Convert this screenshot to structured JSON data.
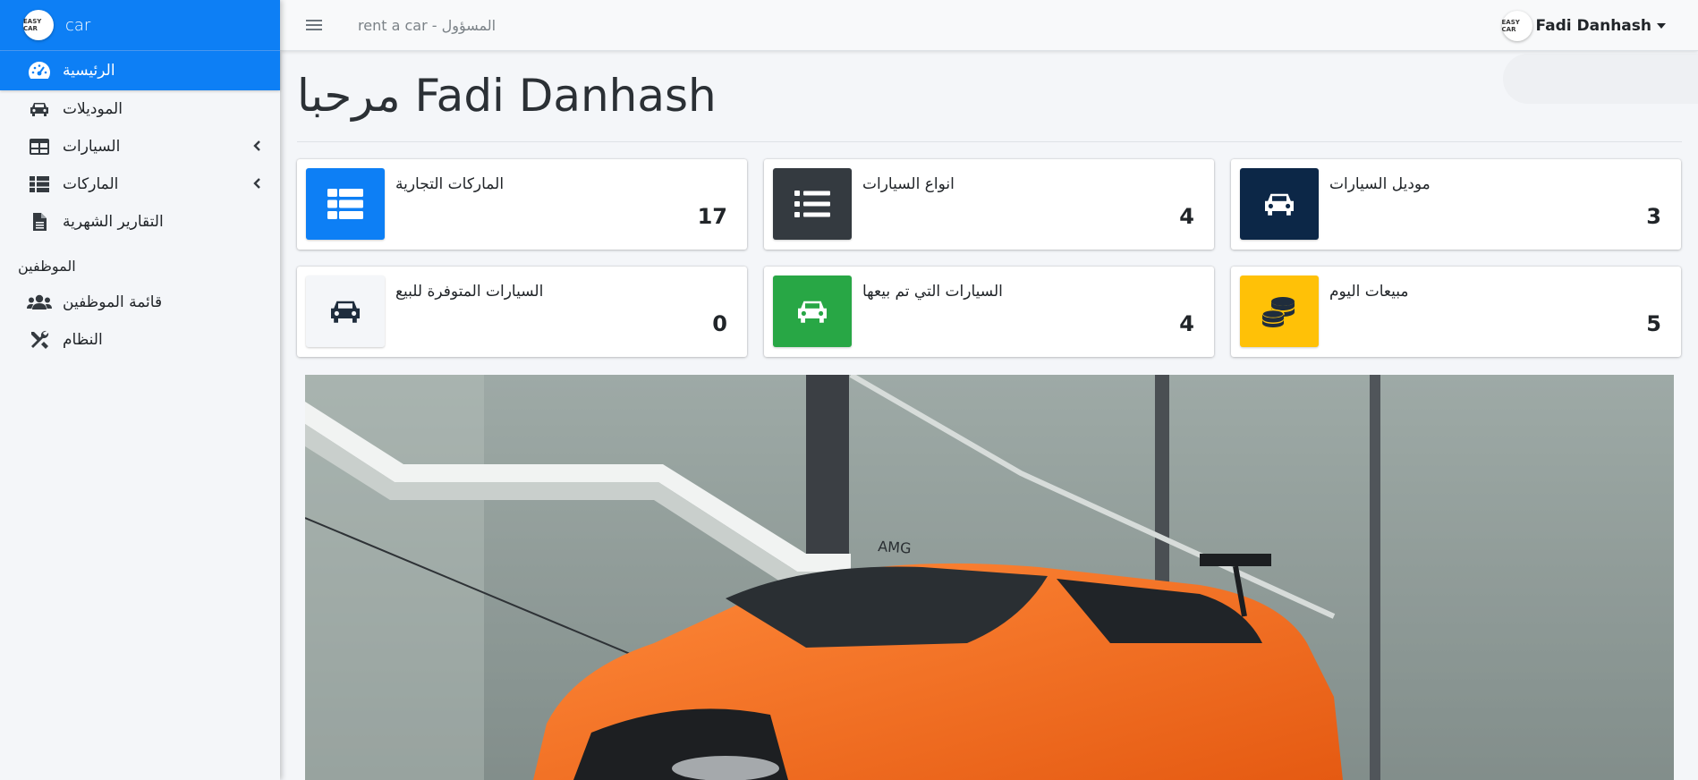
{
  "brand": {
    "text": "car",
    "logo_text": "EASY CAR"
  },
  "sidebar": {
    "items": [
      {
        "label": "الرئيسية",
        "icon": "dashboard-icon",
        "active": true
      },
      {
        "label": "الموديلات",
        "icon": "car-icon"
      },
      {
        "label": "السيارات",
        "icon": "table-icon",
        "has_children": true
      },
      {
        "label": "الماركات",
        "icon": "list-icon",
        "has_children": true
      },
      {
        "label": "التقارير الشهرية",
        "icon": "file-icon"
      }
    ],
    "section_header": "الموظفين",
    "section_items": [
      {
        "label": "قائمة الموظفين",
        "icon": "users-icon"
      },
      {
        "label": "النظام",
        "icon": "tools-icon"
      }
    ]
  },
  "topbar": {
    "title": "rent a car - المسؤول",
    "user_name": "Fadi Danhash",
    "avatar_text": "EASY CAR"
  },
  "page": {
    "title": "مرحبا Fadi Danhash"
  },
  "stats": [
    {
      "label": "الماركات التجارية",
      "value": "17",
      "icon": "list-icon",
      "color": "#0d7ff5"
    },
    {
      "label": "انواع السيارات",
      "value": "4",
      "icon": "list-ul-icon",
      "color": "#343a40"
    },
    {
      "label": "موديل السيارات",
      "value": "3",
      "icon": "car-icon",
      "color": "#0c2747"
    },
    {
      "label": "السيارات المتوفرة للبيع",
      "value": "0",
      "icon": "car-icon",
      "color": "#f4f6f9"
    },
    {
      "label": "السيارات التي تم بيعها",
      "value": "4",
      "icon": "car-icon",
      "color": "#28a745"
    },
    {
      "label": "مبيعات اليوم",
      "value": "5",
      "icon": "coins-icon",
      "color": "#ffc107"
    }
  ],
  "hero": {
    "alt": "orange sports car"
  }
}
